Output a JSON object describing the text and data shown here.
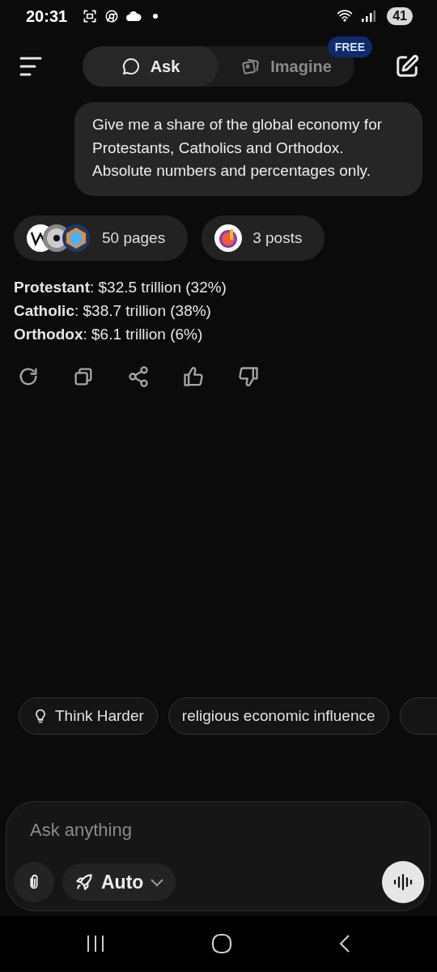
{
  "status_bar": {
    "time": "20:31",
    "battery": "41"
  },
  "header": {
    "tabs": [
      {
        "kind": "chat",
        "label": "Ask",
        "selected": true
      },
      {
        "kind": "images",
        "label": "Imagine",
        "selected": false,
        "badge": "FREE"
      }
    ]
  },
  "user_message": "Give me a share of the global economy for Protestants, Catholics and Orthodox. Absolute numbers and percentages only.",
  "sources": [
    {
      "kind": "web",
      "label": "50 pages"
    },
    {
      "kind": "posts",
      "label": "3 posts"
    }
  ],
  "answer": [
    "**Protestant**: $32.5 trillion (32%)",
    "**Catholic**: $38.7 trillion (38%)",
    "**Orthodox**: $6.1 trillion (6%)"
  ],
  "suggestions": [
    {
      "kind": "think",
      "label": "Think Harder"
    },
    {
      "kind": "query",
      "label": "religious economic influence"
    },
    {
      "kind": "clipped"
    }
  ],
  "composer": {
    "placeholder": "Ask anything",
    "mode": "Auto"
  }
}
